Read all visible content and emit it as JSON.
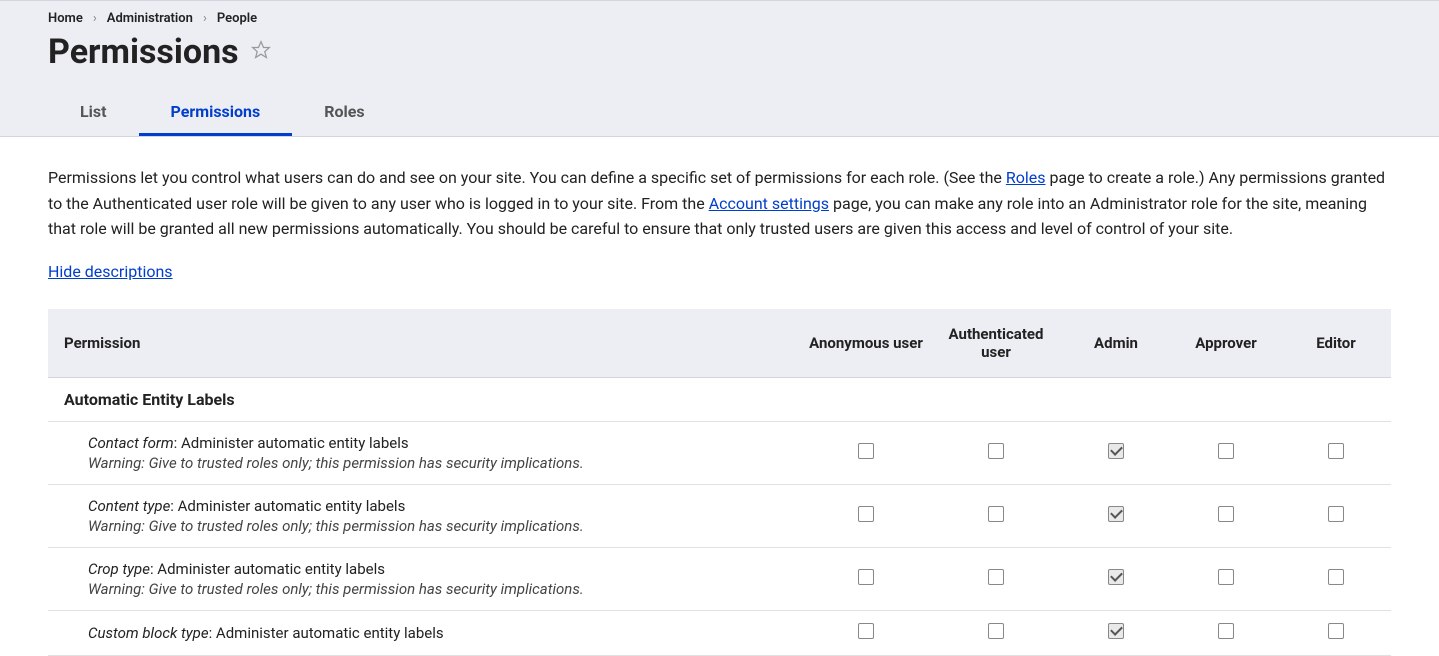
{
  "breadcrumb": {
    "items": [
      "Home",
      "Administration",
      "People"
    ]
  },
  "page_title": "Permissions",
  "tabs": {
    "items": [
      {
        "label": "List",
        "active": false
      },
      {
        "label": "Permissions",
        "active": true
      },
      {
        "label": "Roles",
        "active": false
      }
    ]
  },
  "intro": {
    "part1": "Permissions let you control what users can do and see on your site. You can define a specific set of permissions for each role. (See the ",
    "roles_link": "Roles",
    "part2": " page to create a role.) Any permissions granted to the Authenticated user role will be given to any user who is logged in to your site. From the ",
    "account_settings_link": "Account settings",
    "part3": " page, you can make any role into an Administrator role for the site, meaning that role will be granted all new permissions automatically. You should be careful to ensure that only trusted users are given this access and level of control of your site."
  },
  "hide_descriptions_label": "Hide descriptions",
  "table": {
    "headers": {
      "permission": "Permission",
      "anonymous": "Anonymous user",
      "authenticated": "Authenticated user",
      "admin": "Admin",
      "approver": "Approver",
      "editor": "Editor"
    },
    "group_label": "Automatic Entity Labels",
    "warning_text": "Warning: Give to trusted roles only; this permission has security implications.",
    "perm_suffix": ": Administer automatic entity labels",
    "rows": [
      {
        "entity": "Contact form",
        "checks": {
          "anonymous": false,
          "authenticated": false,
          "admin": true,
          "approver": false,
          "editor": false
        }
      },
      {
        "entity": "Content type",
        "checks": {
          "anonymous": false,
          "authenticated": false,
          "admin": true,
          "approver": false,
          "editor": false
        }
      },
      {
        "entity": "Crop type",
        "checks": {
          "anonymous": false,
          "authenticated": false,
          "admin": true,
          "approver": false,
          "editor": false
        }
      },
      {
        "entity": "Custom block type",
        "checks": {
          "anonymous": false,
          "authenticated": false,
          "admin": true,
          "approver": false,
          "editor": false
        }
      }
    ]
  }
}
